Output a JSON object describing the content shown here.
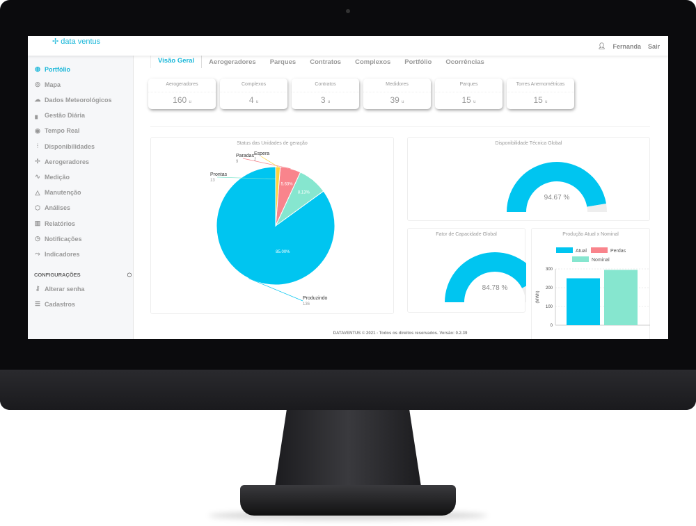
{
  "header": {
    "logo": "data ventus",
    "user": "Fernanda",
    "logout": "Sair"
  },
  "sidebar": {
    "items": [
      {
        "label": "Portfólio",
        "icon": "globe-icon",
        "active": true
      },
      {
        "label": "Mapa",
        "icon": "map-pin-icon"
      },
      {
        "label": "Dados Meteorológicos",
        "icon": "weather-icon"
      },
      {
        "label": "Gestão Diária",
        "icon": "bar-signal-icon"
      },
      {
        "label": "Tempo Real",
        "icon": "eye-icon"
      },
      {
        "label": "Disponibilidades",
        "icon": "sliders-icon"
      },
      {
        "label": "Aerogeradores",
        "icon": "wind-turbine-icon"
      },
      {
        "label": "Medição",
        "icon": "pulse-icon"
      },
      {
        "label": "Manutenção",
        "icon": "warning-icon"
      },
      {
        "label": "Análises",
        "icon": "cube-icon"
      },
      {
        "label": "Relatórios",
        "icon": "chart-icon"
      },
      {
        "label": "Notificações",
        "icon": "clock-icon"
      },
      {
        "label": "Indicadores",
        "icon": "trend-icon"
      }
    ],
    "config_title": "CONFIGURAÇÕES",
    "config_items": [
      {
        "label": "Alterar senha",
        "icon": "key-icon"
      },
      {
        "label": "Cadastros",
        "icon": "database-icon"
      }
    ]
  },
  "tabs": [
    "Visão Geral",
    "Aerogeradores",
    "Parques",
    "Contratos",
    "Complexos",
    "Portfólio",
    "Ocorrências"
  ],
  "cards": [
    {
      "title": "Aerogeradores",
      "value": "160",
      "unit": "u"
    },
    {
      "title": "Complexos",
      "value": "4",
      "unit": "u"
    },
    {
      "title": "Contratos",
      "value": "3",
      "unit": "u"
    },
    {
      "title": "Medidores",
      "value": "39",
      "unit": "u"
    },
    {
      "title": "Parques",
      "value": "15",
      "unit": "u"
    },
    {
      "title": "Torres Anemométricas",
      "value": "15",
      "unit": "u"
    }
  ],
  "footer": "DATAVENTUS © 2021 - Todos os direitos reservados. Versão: 0.2.39",
  "chart_data": [
    {
      "type": "pie",
      "title": "Status das Unidades de geração",
      "slices": [
        {
          "label": "Produzindo",
          "value": 136,
          "percent": "85.00%",
          "color": "#00c5f0"
        },
        {
          "label": "Prontas",
          "value": 13,
          "percent": "8.13%",
          "color": "#86e6cf"
        },
        {
          "label": "Paradas",
          "value": 9,
          "percent": "5.63%",
          "color": "#f9848c"
        },
        {
          "label": "Espera",
          "value": 2,
          "percent": "",
          "color": "#ffd23c"
        }
      ]
    },
    {
      "type": "gauge",
      "title": "Disponibilidade Técnica Global",
      "value": 94.67,
      "unit": "%",
      "max": 100,
      "color": "#00c5f0"
    },
    {
      "type": "gauge",
      "title": "Fator de Capacidade Global",
      "value": 84.78,
      "unit": "%",
      "max": 100,
      "color": "#00c5f0"
    },
    {
      "type": "bar",
      "title": "Produção Atual x Nominal",
      "ylabel": "(MWh)",
      "ylim": [
        0,
        300
      ],
      "yticks": [
        0,
        100,
        200,
        300
      ],
      "legend": [
        {
          "name": "Atual",
          "color": "#00c5f0"
        },
        {
          "name": "Perdas",
          "color": "#f9848c"
        },
        {
          "name": "Nominal",
          "color": "#86e6cf"
        }
      ],
      "series": [
        {
          "name": "Atual",
          "value": 250,
          "color": "#00c5f0"
        },
        {
          "name": "Nominal",
          "value": 295,
          "color": "#86e6cf"
        }
      ]
    }
  ]
}
